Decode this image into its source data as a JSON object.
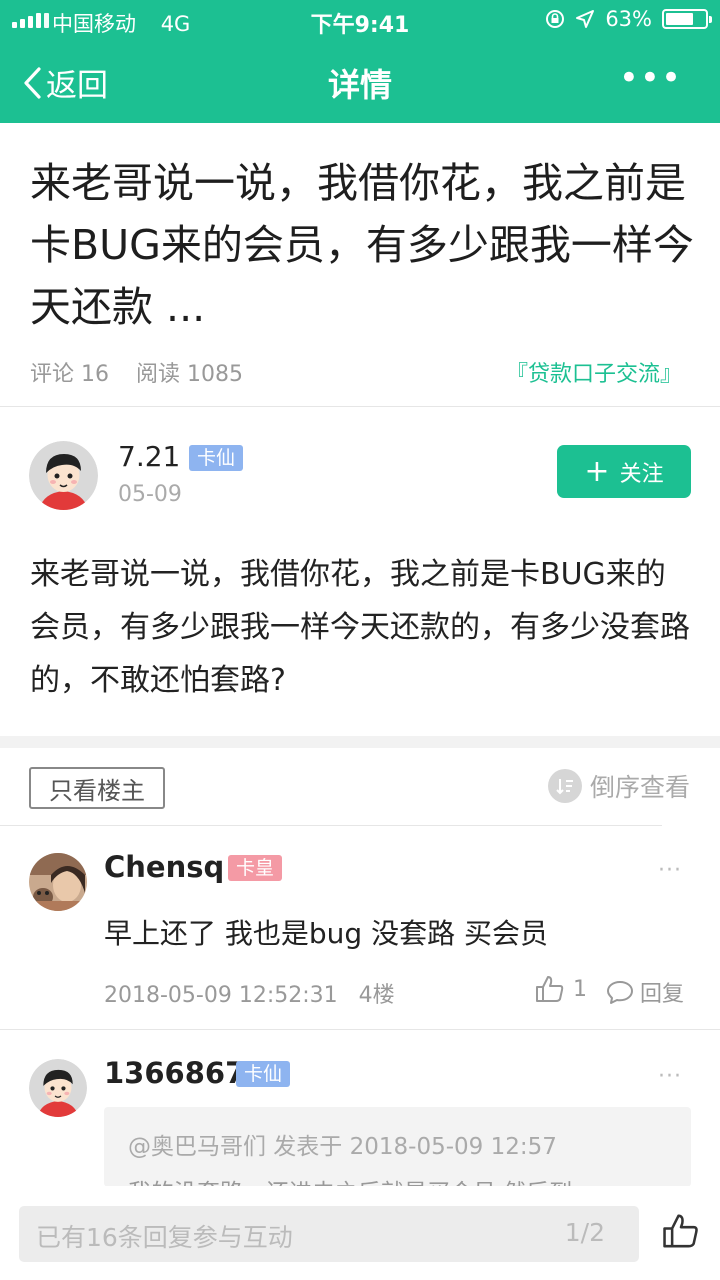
{
  "status_bar": {
    "carrier": "中国移动",
    "network": "4G",
    "time": "下午9:41",
    "battery_percent": "63%",
    "battery_level": 0.63
  },
  "nav": {
    "back_label": "返回",
    "title": "详情",
    "more_icon": "ellipsis-icon"
  },
  "post": {
    "title": "来老哥说一说，我借你花，我之前是卡BUG来的会员，有多少跟我一样今天还款 ...",
    "comment_count": "评论 16",
    "read_count": "阅读 1085",
    "category": "『贷款口子交流』",
    "author": {
      "name": "7.21",
      "badge": "卡仙",
      "date": "05-09"
    },
    "follow_label": "关注",
    "body": "来老哥说一说，我借你花，我之前是卡BUG来的会员，有多少跟我一样今天还款的，有多少没套路的，不敢还怕套路?"
  },
  "filters": {
    "owner_only": "只看楼主",
    "reverse": "倒序查看"
  },
  "comments": [
    {
      "name": "Chensq",
      "badge": "卡皇",
      "text": "早上还了 我也是bug 没套路 买会员",
      "datetime": "2018-05-09 12:52:31",
      "floor": "4楼",
      "likes": "1",
      "reply_label": "回复"
    },
    {
      "name": "1366867",
      "badge": "卡仙",
      "quote_header": "@奥巴马哥们 发表于 2018-05-09 12:57",
      "quote_text": "我的没套路，还进去之后就是买会员 然后到"
    }
  ],
  "bottom_bar": {
    "placeholder": "已有16条回复参与互动",
    "page": "1/2"
  },
  "colors": {
    "accent": "#1cc092",
    "badge_blue": "#8eb4f0",
    "badge_pink": "#f49aa5"
  }
}
